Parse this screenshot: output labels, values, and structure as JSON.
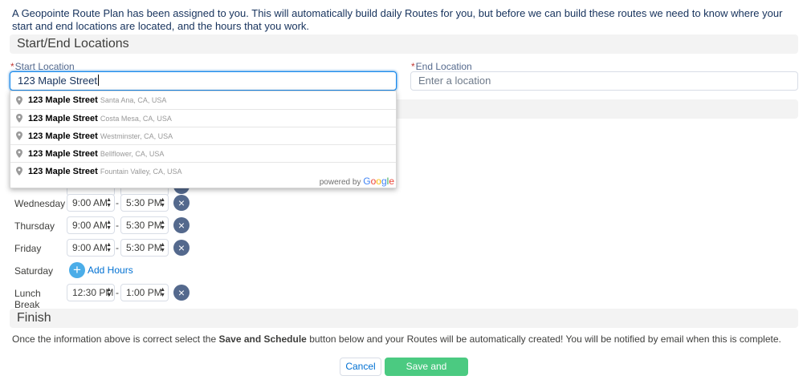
{
  "intro": {
    "text": "A Geopointe Route Plan has been assigned to you. This will automatically build daily Routes for you, but before we can build these routes we need to know where your start and end locations are located, and the hours that you work."
  },
  "sections": {
    "start_end": "Start/End Locations",
    "finish": "Finish"
  },
  "start_location": {
    "required_mark": "*",
    "label": "Start Location",
    "value": "123 Maple Street"
  },
  "end_location": {
    "required_mark": "*",
    "label": "End Location",
    "placeholder": "Enter a location"
  },
  "autocomplete": {
    "suggestions": [
      {
        "main": "123 Maple Street",
        "secondary": "Santa Ana, CA, USA"
      },
      {
        "main": "123 Maple Street",
        "secondary": "Costa Mesa, CA, USA"
      },
      {
        "main": "123 Maple Street",
        "secondary": "Westminster, CA, USA"
      },
      {
        "main": "123 Maple Street",
        "secondary": "Bellflower, CA, USA"
      },
      {
        "main": "123 Maple Street",
        "secondary": "Fountain Valley, CA, USA"
      }
    ],
    "powered_by": "powered by",
    "brand": [
      "G",
      "o",
      "o",
      "g",
      "l",
      "e"
    ]
  },
  "schedule": {
    "separator": "-",
    "remove_glyph": "×",
    "add_glyph": "+",
    "rows": [
      {
        "day": "Wednesday",
        "start": "9:00 AM",
        "end": "5:30 PM"
      },
      {
        "day": "Thursday",
        "start": "9:00 AM",
        "end": "5:30 PM"
      },
      {
        "day": "Friday",
        "start": "9:00 AM",
        "end": "5:30 PM"
      },
      {
        "day": "Saturday",
        "add_label": "Add Hours"
      },
      {
        "day": "Lunch Break",
        "start": "12:30 PM",
        "end": "1:00 PM"
      }
    ]
  },
  "finish": {
    "text_before": "Once the information above is correct select the ",
    "text_bold": "Save and Schedule",
    "text_after": " button below and your Routes will be automatically created! You will be notified by email when this is complete."
  },
  "buttons": {
    "cancel": "Cancel",
    "save": "Save and Schedule"
  },
  "colors": {
    "save_button": "#4bca81",
    "remove_button": "#54698d",
    "add_button": "#4bade8",
    "focus_border": "#1589ee",
    "required": "#c23934"
  }
}
